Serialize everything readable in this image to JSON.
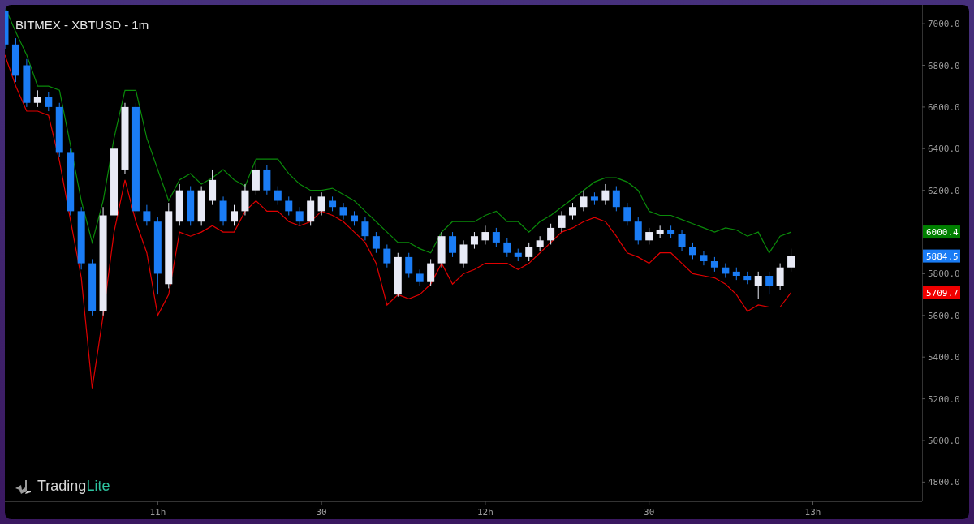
{
  "logo": {
    "parts": [
      "Trading",
      "Lite"
    ]
  },
  "chart": {
    "chart_data": {
      "type": "candlestick",
      "title": "BITMEX - XBTUSD - 1m",
      "categories": [
        null,
        null,
        null,
        null,
        null,
        null,
        null,
        null,
        null,
        null,
        null,
        null,
        null,
        null,
        "11h",
        null,
        null,
        null,
        null,
        null,
        null,
        null,
        null,
        null,
        null,
        null,
        null,
        null,
        null,
        "30",
        null,
        null,
        null,
        null,
        null,
        null,
        null,
        null,
        null,
        null,
        null,
        null,
        null,
        null,
        "12h",
        null,
        null,
        null,
        null,
        null,
        null,
        null,
        null,
        null,
        null,
        null,
        null,
        null,
        null,
        "30",
        null,
        null,
        null,
        null,
        null,
        null,
        null,
        null,
        null,
        null,
        null,
        null,
        null,
        null,
        "13h",
        null,
        null,
        null,
        null,
        null,
        null,
        null,
        null,
        null,
        null
      ],
      "ylim": [
        4708,
        7090
      ],
      "yticks": [
        {
          "value": 4800,
          "label": "4800.0"
        },
        {
          "value": 5000,
          "label": "5000.0"
        },
        {
          "value": 5200,
          "label": "5200.0"
        },
        {
          "value": 5400,
          "label": "5400.0"
        },
        {
          "value": 5600,
          "label": "5600.0"
        },
        {
          "value": 5800,
          "label": "5800.0"
        },
        {
          "value": 6200,
          "label": "6200.0"
        },
        {
          "value": 6400,
          "label": "6400.0"
        },
        {
          "value": 6600,
          "label": "6600.0"
        },
        {
          "value": 6800,
          "label": "6800.0"
        },
        {
          "value": 7000,
          "label": "7000.0"
        }
      ],
      "ohlc": [
        [
          7060,
          7080,
          6880,
          6900
        ],
        [
          6900,
          6930,
          6720,
          6750
        ],
        [
          6800,
          6830,
          6600,
          6620
        ],
        [
          6620,
          6680,
          6600,
          6650
        ],
        [
          6650,
          6670,
          6580,
          6600
        ],
        [
          6600,
          6620,
          6360,
          6380
        ],
        [
          6380,
          6400,
          6080,
          6100
        ],
        [
          6100,
          6120,
          5820,
          5850
        ],
        [
          5850,
          5870,
          5600,
          5620
        ],
        [
          5620,
          6120,
          5600,
          6080
        ],
        [
          6080,
          6420,
          6060,
          6400
        ],
        [
          6300,
          6620,
          6280,
          6600
        ],
        [
          6600,
          6620,
          6080,
          6100
        ],
        [
          6100,
          6130,
          6030,
          6050
        ],
        [
          6050,
          6070,
          5700,
          5800
        ],
        [
          5750,
          6140,
          5730,
          6100
        ],
        [
          6050,
          6230,
          6030,
          6200
        ],
        [
          6200,
          6220,
          6030,
          6050
        ],
        [
          6050,
          6220,
          6030,
          6200
        ],
        [
          6150,
          6300,
          6130,
          6250
        ],
        [
          6150,
          6170,
          6030,
          6050
        ],
        [
          6050,
          6130,
          6030,
          6100
        ],
        [
          6100,
          6230,
          6080,
          6200
        ],
        [
          6200,
          6330,
          6180,
          6300
        ],
        [
          6300,
          6320,
          6180,
          6200
        ],
        [
          6200,
          6220,
          6130,
          6150
        ],
        [
          6150,
          6170,
          6080,
          6100
        ],
        [
          6100,
          6120,
          6030,
          6050
        ],
        [
          6050,
          6170,
          6030,
          6150
        ],
        [
          6100,
          6190,
          6080,
          6170
        ],
        [
          6150,
          6170,
          6100,
          6120
        ],
        [
          6120,
          6140,
          6060,
          6080
        ],
        [
          6080,
          6100,
          6030,
          6050
        ],
        [
          6050,
          6070,
          5960,
          5980
        ],
        [
          5980,
          6000,
          5900,
          5920
        ],
        [
          5920,
          5940,
          5830,
          5850
        ],
        [
          5700,
          5900,
          5690,
          5880
        ],
        [
          5880,
          5900,
          5780,
          5800
        ],
        [
          5800,
          5820,
          5740,
          5760
        ],
        [
          5760,
          5870,
          5740,
          5850
        ],
        [
          5850,
          6000,
          5830,
          5980
        ],
        [
          5980,
          6000,
          5880,
          5900
        ],
        [
          5850,
          5960,
          5830,
          5940
        ],
        [
          5940,
          6000,
          5920,
          5980
        ],
        [
          5960,
          6030,
          5940,
          6000
        ],
        [
          6000,
          6020,
          5930,
          5950
        ],
        [
          5950,
          5970,
          5880,
          5900
        ],
        [
          5900,
          5920,
          5860,
          5880
        ],
        [
          5880,
          5950,
          5860,
          5930
        ],
        [
          5930,
          5980,
          5910,
          5960
        ],
        [
          5960,
          6040,
          5940,
          6020
        ],
        [
          6020,
          6100,
          6000,
          6080
        ],
        [
          6080,
          6140,
          6060,
          6120
        ],
        [
          6120,
          6200,
          6100,
          6170
        ],
        [
          6170,
          6190,
          6130,
          6150
        ],
        [
          6150,
          6230,
          6130,
          6200
        ],
        [
          6200,
          6220,
          6100,
          6120
        ],
        [
          6120,
          6140,
          6030,
          6050
        ],
        [
          6050,
          6070,
          5940,
          5960
        ],
        [
          5960,
          6020,
          5940,
          6000
        ],
        [
          5990,
          6030,
          5970,
          6010
        ],
        [
          6010,
          6030,
          5970,
          5990
        ],
        [
          5990,
          6010,
          5910,
          5930
        ],
        [
          5930,
          5950,
          5870,
          5890
        ],
        [
          5890,
          5910,
          5840,
          5860
        ],
        [
          5860,
          5880,
          5810,
          5830
        ],
        [
          5830,
          5850,
          5780,
          5800
        ],
        [
          5810,
          5830,
          5770,
          5790
        ],
        [
          5790,
          5810,
          5750,
          5770
        ],
        [
          5740,
          5810,
          5680,
          5790
        ],
        [
          5790,
          5810,
          5700,
          5740
        ],
        [
          5740,
          5850,
          5720,
          5830
        ],
        [
          5830,
          5920,
          5810,
          5885
        ],
        null,
        null,
        null,
        null,
        null,
        null,
        null,
        null,
        null,
        null,
        null,
        null
      ],
      "series": [
        {
          "type": "line",
          "color": "#0a8a0a",
          "values": [
            7080,
            6960,
            6850,
            6700,
            6700,
            6680,
            6420,
            6150,
            5950,
            6150,
            6450,
            6680,
            6680,
            6450,
            6300,
            6150,
            6250,
            6280,
            6230,
            6260,
            6300,
            6250,
            6220,
            6350,
            6350,
            6350,
            6280,
            6230,
            6200,
            6200,
            6210,
            6180,
            6150,
            6100,
            6050,
            6000,
            5950,
            5950,
            5920,
            5900,
            6000,
            6050,
            6050,
            6050,
            6080,
            6100,
            6050,
            6050,
            6000,
            6050,
            6080,
            6120,
            6160,
            6200,
            6240,
            6260,
            6260,
            6240,
            6200,
            6100,
            6080,
            6080,
            6060,
            6040,
            6020,
            6000,
            6020,
            6010,
            5980,
            6000,
            5900,
            5980,
            6000,
            null,
            null,
            null,
            null,
            null,
            null,
            null,
            null,
            null,
            null,
            null,
            null
          ]
        },
        {
          "type": "line",
          "color": "#e00000",
          "values": [
            6850,
            6700,
            6580,
            6580,
            6560,
            6340,
            6060,
            5780,
            5250,
            5600,
            6000,
            6250,
            6050,
            5900,
            5600,
            5700,
            6000,
            5980,
            6000,
            6030,
            6000,
            6000,
            6100,
            6150,
            6100,
            6100,
            6050,
            6030,
            6050,
            6100,
            6080,
            6050,
            6000,
            5950,
            5850,
            5650,
            5700,
            5680,
            5700,
            5750,
            5850,
            5750,
            5800,
            5820,
            5850,
            5850,
            5850,
            5820,
            5850,
            5900,
            5950,
            6000,
            6020,
            6050,
            6070,
            6050,
            5980,
            5900,
            5880,
            5850,
            5900,
            5900,
            5850,
            5800,
            5790,
            5780,
            5750,
            5700,
            5620,
            5650,
            5640,
            5640,
            5710,
            null,
            null,
            null,
            null,
            null,
            null,
            null,
            null,
            null,
            null,
            null,
            null
          ]
        }
      ]
    },
    "price_labels": [
      {
        "text": "6000.4",
        "color": "#008000"
      },
      {
        "text": "5884.5",
        "color": "#1a7cf5"
      },
      {
        "text": "5709.7",
        "color": "#f00000"
      }
    ]
  }
}
